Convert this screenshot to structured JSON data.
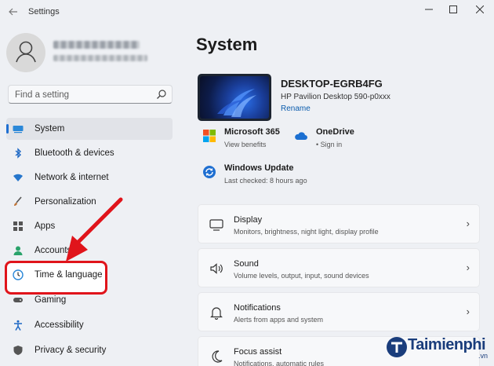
{
  "window": {
    "title": "Settings",
    "controls": [
      "minimize",
      "maximize",
      "close"
    ]
  },
  "profile": {
    "name_blurred": true
  },
  "search": {
    "placeholder": "Find a setting"
  },
  "nav": {
    "items": [
      {
        "label": "System",
        "icon": "monitor-icon",
        "active": true
      },
      {
        "label": "Bluetooth & devices",
        "icon": "bluetooth-icon"
      },
      {
        "label": "Network & internet",
        "icon": "wifi-icon"
      },
      {
        "label": "Personalization",
        "icon": "brush-icon"
      },
      {
        "label": "Apps",
        "icon": "apps-icon"
      },
      {
        "label": "Accounts",
        "icon": "account-icon"
      },
      {
        "label": "Time & language",
        "icon": "globe-clock-icon",
        "highlighted": true
      },
      {
        "label": "Gaming",
        "icon": "gamepad-icon"
      },
      {
        "label": "Accessibility",
        "icon": "accessibility-icon"
      },
      {
        "label": "Privacy & security",
        "icon": "shield-icon"
      }
    ]
  },
  "main": {
    "title": "System",
    "device": {
      "name": "DESKTOP-EGRB4FG",
      "model": "HP Pavilion Desktop 590-p0xxx",
      "rename": "Rename"
    },
    "tiles": [
      {
        "title": "Microsoft 365",
        "sub": "View benefits",
        "icon": "microsoft-logo-icon"
      },
      {
        "title": "OneDrive",
        "sub": "• Sign in",
        "icon": "cloud-icon"
      },
      {
        "title": "Windows Update",
        "sub": "Last checked: 8 hours ago",
        "icon": "update-icon"
      }
    ],
    "cards": [
      {
        "title": "Display",
        "sub": "Monitors, brightness, night light, display profile",
        "icon": "display-icon"
      },
      {
        "title": "Sound",
        "sub": "Volume levels, output, input, sound devices",
        "icon": "speaker-icon"
      },
      {
        "title": "Notifications",
        "sub": "Alerts from apps and system",
        "icon": "bell-icon"
      },
      {
        "title": "Focus assist",
        "sub": "Notifications, automatic rules",
        "icon": "moon-icon"
      }
    ]
  },
  "watermark": {
    "text": "Taimienphi",
    "sub": ".vn"
  },
  "colors": {
    "accent": "#1f6fd1",
    "annotation_red": "#e0141b",
    "background": "#eef0f4"
  }
}
